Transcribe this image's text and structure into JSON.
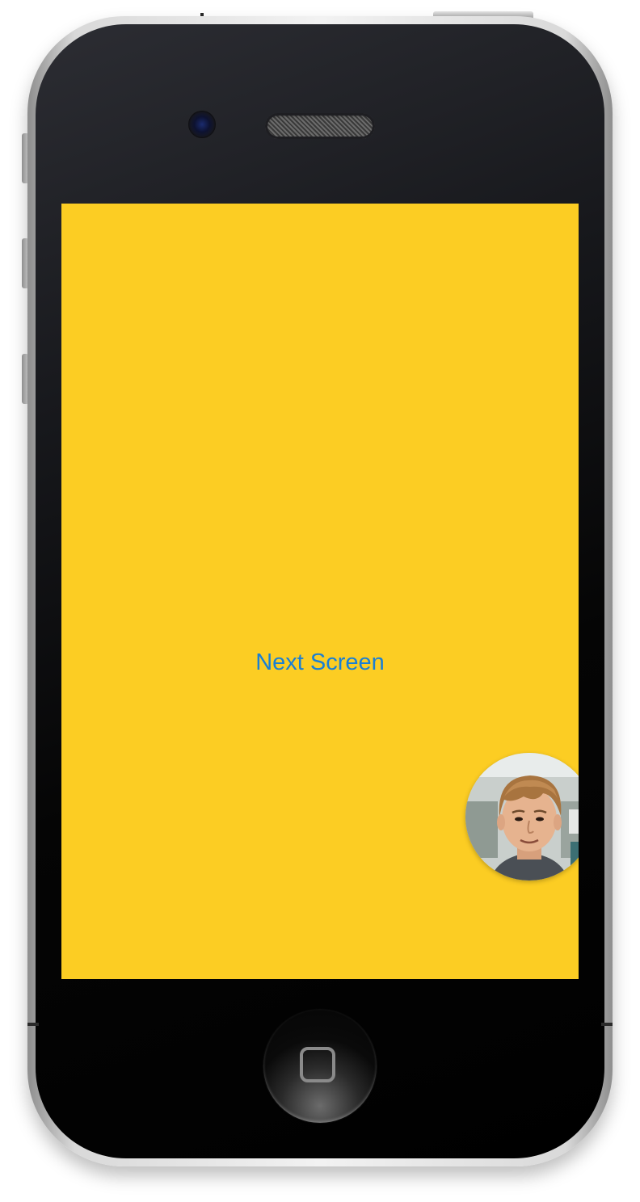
{
  "screen": {
    "background_color": "#fccd23",
    "next_button_label": "Next Screen",
    "next_button_color": "#1a7fd4"
  },
  "avatar": {
    "icon": "user-photo-avatar"
  },
  "device": {
    "model": "iphone-4-simulator-frame",
    "home_button_icon": "home-square-icon"
  }
}
